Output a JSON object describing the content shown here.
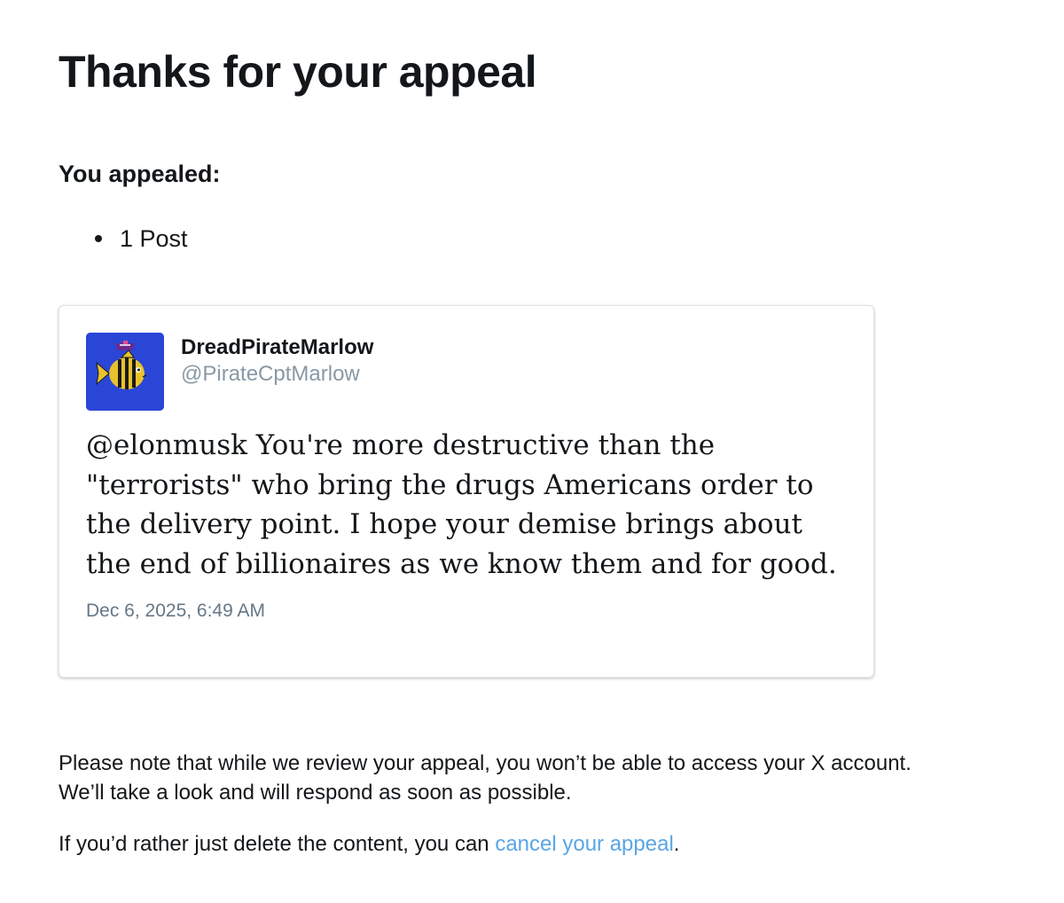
{
  "heading": {
    "title": "Thanks for your appeal",
    "subheading": "You appealed:"
  },
  "appealed_items": [
    {
      "label": "1 Post"
    }
  ],
  "tweet": {
    "display_name": "DreadPirateMarlow",
    "handle": "@PirateCptMarlow",
    "text": "@elonmusk You're more destructive than the \"terrorists\" who bring the drugs Americans order to the delivery point. I hope your demise brings about the end of billionaires as we know them and for good.",
    "timestamp": "Dec 6, 2025, 6:49 AM",
    "avatar": {
      "icon": "pirate-fish-icon",
      "background": "#2a46d6"
    }
  },
  "footer": {
    "note_line1": "Please note that while we review your appeal, you won’t be able to access your X account.",
    "note_line2": "We’ll take a look and will respond as soon as possible.",
    "cancel_prefix": "If you’d rather just delete the content, you can ",
    "cancel_link": "cancel your appeal",
    "cancel_suffix": "."
  },
  "colors": {
    "text": "#14171a",
    "handle": "#8899a6",
    "timestamp": "#657786",
    "link": "#5aa6e6"
  }
}
